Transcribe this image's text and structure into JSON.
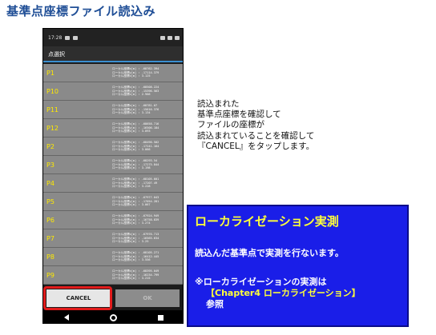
{
  "page_title": "基準点座標ファイル読込み",
  "phone": {
    "status_time": "17:28",
    "dialog_title": "点選択",
    "points": [
      {
        "id": "P1",
        "lines": [
          "ローカル座標x[m] : -68762.394",
          "ローカル座標y[m] : -17114.379",
          "ローカル座標z[m] : 3.125"
        ]
      },
      {
        "id": "P10",
        "lines": [
          "ローカル座標x[m] : -68508.224",
          "ローカル座標y[m] : -15396.563",
          "ローカル座標z[m] : 2.966"
        ]
      },
      {
        "id": "P11",
        "lines": [
          "ローカル座標x[m] : -68781.07",
          "ローカル座標y[m] : -15616.376",
          "ローカル座標z[m] : 3.134"
        ]
      },
      {
        "id": "P12",
        "lines": [
          "ローカル座標x[m] : -68658.716",
          "ローカル座標y[m] : -16506.184",
          "ローカル座標z[m] : 3.093"
        ]
      },
      {
        "id": "P2",
        "lines": [
          "ローカル座標x[m] : -68490.502",
          "ローカル座標y[m] : -17241.164",
          "ローカル座標z[m] : 3.066"
        ]
      },
      {
        "id": "P3",
        "lines": [
          "ローカル座標x[m] : -68293.54",
          "ローカル座標y[m] : -17275.844",
          "ローカル座標z[m] : 3.198"
        ]
      },
      {
        "id": "P4",
        "lines": [
          "ローカル座標x[m] : -68105.601",
          "ローカル座標y[m] : -17207.49",
          "ローカル座標z[m] : 3.228"
        ]
      },
      {
        "id": "P5",
        "lines": [
          "ローカル座標x[m] : -67977.043",
          "ローカル座標y[m] : -17054.281",
          "ローカル座標z[m] : 3.067"
        ]
      },
      {
        "id": "P6",
        "lines": [
          "ローカル座標x[m] : -67924.949",
          "ローカル座標y[m] : -16758.839",
          "ローカル座標z[m] : 3.274"
        ]
      },
      {
        "id": "P7",
        "lines": [
          "ローカル座標x[m] : -67976.713",
          "ローカル座標y[m] : -16565.634",
          "ローカル座標z[m] : 3.25"
        ]
      },
      {
        "id": "P8",
        "lines": [
          "ローカル座標x[m] : -68105.271",
          "ローカル座標y[m] : -16412.445",
          "ローカル座標z[m] : 3.556"
        ]
      },
      {
        "id": "P9",
        "lines": [
          "ローカル座標x[m] : -68395.049",
          "ローカル座標y[m] : -16234.799",
          "ローカル座標z[m] : 3.215"
        ]
      }
    ],
    "cancel_label": "CANCEL",
    "ok_label": "OK"
  },
  "instructions": [
    "読込まれた",
    "基準点座標を確認して",
    "ファイルの座標が",
    "読込まれていることを確認して",
    "『CANCEL』をタップします。"
  ],
  "info_box": {
    "title": "ローカライゼーション実測",
    "line1": "読込んだ基準点で実測を行ないます。",
    "note1": "※ローカライゼーションの実測は",
    "note2": "【Chapter4 ローカライゼーション】",
    "note3": "参照"
  },
  "colors": {
    "title_blue": "#1f4e96",
    "point_yellow": "#ffea00",
    "highlight_red": "#e21b1b",
    "info_blue": "#1a1ee8"
  }
}
